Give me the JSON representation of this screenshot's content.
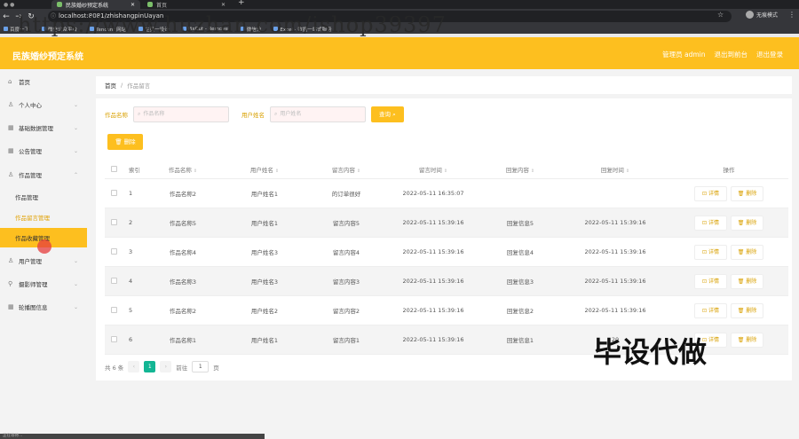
{
  "browser": {
    "tabs": [
      {
        "title": "民族婚纱预定系统",
        "active": true
      },
      {
        "title": "首页",
        "active": false
      }
    ],
    "url": "localhost:8081/zhishangpinUayan",
    "profile_label": "无痕模式",
    "bookmarks": [
      "百度一下",
      "微信公众平台",
      "Tencent 网站",
      "主页一设计",
      "PixCut - Remove",
      "微信分",
      "Excel · 数据一站式服务"
    ]
  },
  "watermark_text": "https://www.huzhan.com/ishop39397",
  "stamp_text": "毕设代做",
  "header": {
    "title": "民族婚纱预定系统",
    "links": [
      "管理员 admin",
      "退出到前台",
      "退出登录"
    ]
  },
  "sidebar": {
    "items": [
      {
        "label": "首页",
        "icon": "home-icon"
      },
      {
        "label": "个人中心",
        "icon": "user-icon"
      },
      {
        "label": "基础数据管理",
        "icon": "grid-icon"
      },
      {
        "label": "公告管理",
        "icon": "grid-icon"
      },
      {
        "label": "作品管理",
        "icon": "user-icon"
      }
    ],
    "sub_items": [
      "作品管理",
      "作品留言管理",
      "作品收藏管理"
    ],
    "items_after": [
      {
        "label": "用户管理",
        "icon": "user-icon"
      },
      {
        "label": "摄影师管理",
        "icon": "location-icon"
      },
      {
        "label": "轮播图信息",
        "icon": "grid-icon"
      }
    ]
  },
  "breadcrumb": {
    "home": "首页",
    "separator": "/",
    "current": "作品留言"
  },
  "search": {
    "label1": "作品名称",
    "placeholder1": "作品名称",
    "label2": "用户姓名",
    "placeholder2": "用户姓名",
    "button": "查询"
  },
  "delete_button": "删除",
  "table": {
    "headers": [
      "索引",
      "作品名称",
      "用户姓名",
      "留言内容",
      "留言时间",
      "回复内容",
      "回复时间",
      "操作"
    ],
    "rows": [
      {
        "no": "1",
        "work": "作品名称2",
        "user": "用户姓名1",
        "msg": "的订单很好",
        "msg_time": "2022-05-11 16:35:07",
        "reply": "",
        "reply_time": ""
      },
      {
        "no": "2",
        "work": "作品名称5",
        "user": "用户姓名1",
        "msg": "留言内容5",
        "msg_time": "2022-05-11 15:39:16",
        "reply": "回复信息5",
        "reply_time": "2022-05-11 15:39:16"
      },
      {
        "no": "3",
        "work": "作品名称4",
        "user": "用户姓名3",
        "msg": "留言内容4",
        "msg_time": "2022-05-11 15:39:16",
        "reply": "回复信息4",
        "reply_time": "2022-05-11 15:39:16"
      },
      {
        "no": "4",
        "work": "作品名称3",
        "user": "用户姓名3",
        "msg": "留言内容3",
        "msg_time": "2022-05-11 15:39:16",
        "reply": "回复信息3",
        "reply_time": "2022-05-11 15:39:16"
      },
      {
        "no": "5",
        "work": "作品名称2",
        "user": "用户姓名2",
        "msg": "留言内容2",
        "msg_time": "2022-05-11 15:39:16",
        "reply": "回复信息2",
        "reply_time": "2022-05-11 15:39:16"
      },
      {
        "no": "6",
        "work": "作品名称1",
        "user": "用户姓名1",
        "msg": "留言内容1",
        "msg_time": "2022-05-11 15:39:16",
        "reply": "回复信息1",
        "reply_time": "20"
      }
    ],
    "detail_label": "详情",
    "delete_label": "删除"
  },
  "pagination": {
    "total": "共 6 条",
    "current_page": "1",
    "goto_label": "前往",
    "goto_value": "1",
    "page_suffix": "页"
  },
  "status_bar": "正在等待…",
  "colors": {
    "brand": "#fdbf1f",
    "page_active": "#13b694"
  }
}
